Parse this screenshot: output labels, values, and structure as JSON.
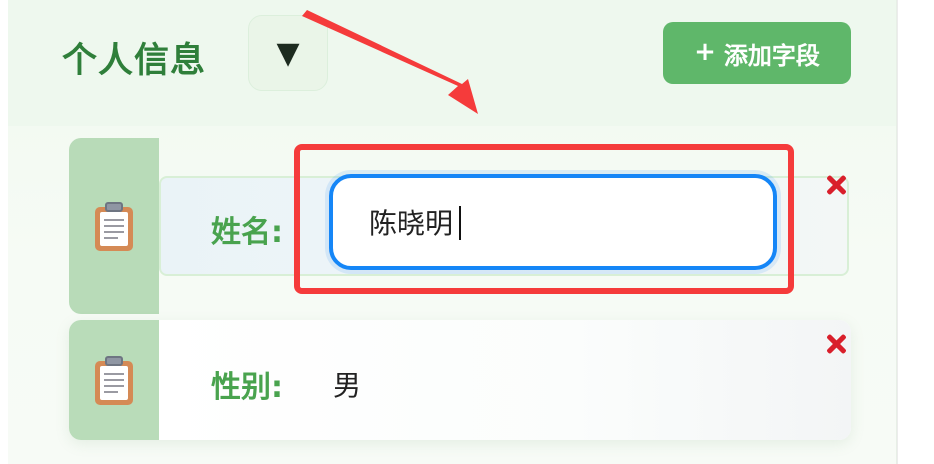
{
  "section": {
    "title": "个人信息",
    "collapse_symbol": "▼",
    "add_button_label": "添加字段",
    "add_button_icon": "plus-icon"
  },
  "fields": [
    {
      "icon": "clipboard-icon",
      "label": "姓名:",
      "value": "陈晓明",
      "editing": true,
      "delete_icon": "close-icon"
    },
    {
      "icon": "clipboard-icon",
      "label": "性别:",
      "value": "男",
      "editing": false,
      "delete_icon": "close-icon"
    }
  ],
  "annotations": {
    "highlight_color": "#f53b3b",
    "focus_color": "#1586f7",
    "accent_green": "#5fb76a",
    "label_green": "#49a34e"
  }
}
